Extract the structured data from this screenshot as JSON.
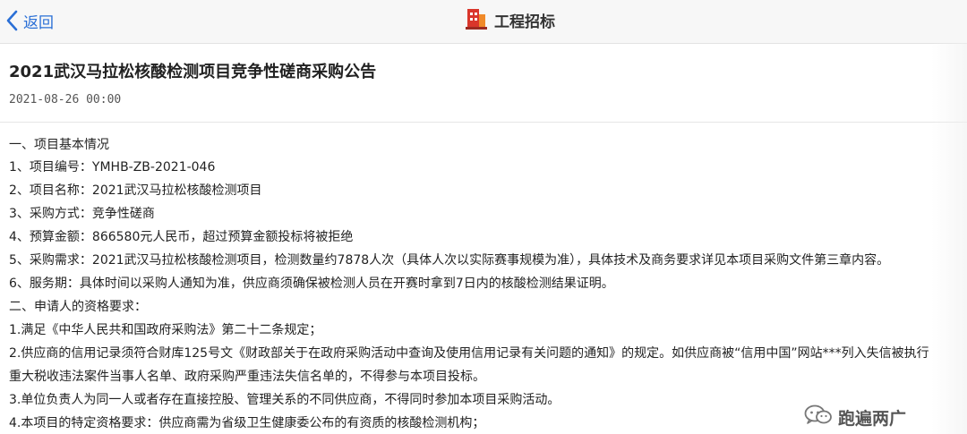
{
  "nav": {
    "back_label": "返回",
    "title": "工程招标"
  },
  "article": {
    "title": "2021武汉马拉松核酸检测项目竞争性磋商采购公告",
    "date": "2021-08-26 00:00",
    "lines": [
      "一、项目基本情况",
      "1、项目编号：YMHB-ZB-2021-046",
      "2、项目名称：2021武汉马拉松核酸检测项目",
      "3、采购方式：竞争性磋商",
      "4、预算金额：866580元人民币，超过预算金额投标将被拒绝",
      "5、采购需求：2021武汉马拉松核酸检测项目，检测数量约7878人次（具体人次以实际赛事规模为准），具体技术及商务要求详见本项目采购文件第三章内容。",
      "6、服务期：具体时间以采购人通知为准，供应商须确保被检测人员在开赛时拿到7日内的核酸检测结果证明。",
      "二、申请人的资格要求：",
      "1.满足《中华人民共和国政府采购法》第二十二条规定；",
      "2.供应商的信用记录须符合财库125号文《财政部关于在政府采购活动中查询及使用信用记录有关问题的通知》的规定。如供应商被“信用中国”网站***列入失信被执行",
      "重大税收违法案件当事人名单、政府采购严重违法失信名单的，不得参与本项目投标。",
      "3.单位负责人为同一人或者存在直接控股、管理关系的不同供应商，不得同时参加本项目采购活动。",
      "4.本项目的特定资格要求：供应商需为省级卫生健康委公布的有资质的核酸检测机构；"
    ]
  },
  "watermark": {
    "text": "跑遍两广",
    "icon": "wechat-icon"
  },
  "colors": {
    "accent": "#2a6fd6",
    "logo_red": "#d9362b",
    "logo_orange": "#f08a2a"
  }
}
